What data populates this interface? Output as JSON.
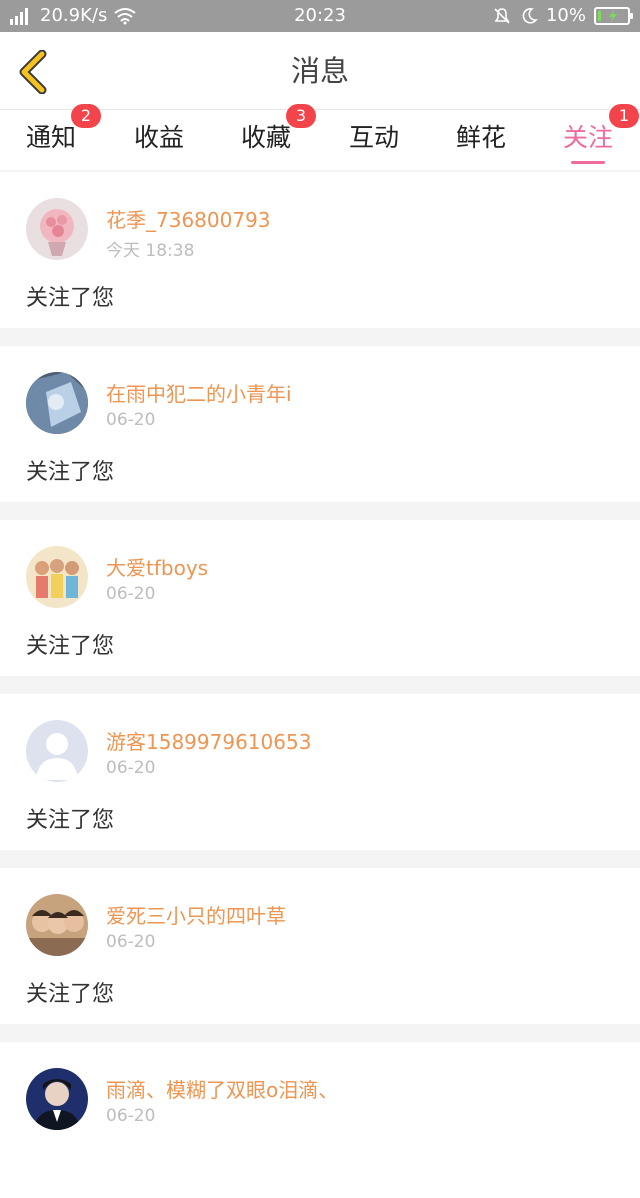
{
  "status_bar": {
    "network": "2G",
    "speed": "20.9K/s",
    "time": "20:23",
    "battery": "10%"
  },
  "header": {
    "title": "消息"
  },
  "tabs": [
    {
      "label": "通知",
      "badge": "2"
    },
    {
      "label": "收益",
      "badge": ""
    },
    {
      "label": "收藏",
      "badge": "3"
    },
    {
      "label": "互动",
      "badge": ""
    },
    {
      "label": "鲜花",
      "badge": ""
    },
    {
      "label": "关注",
      "badge": "1"
    }
  ],
  "active_tab": "关注",
  "colors": {
    "accent": "#f06a9e",
    "username": "#ee9552",
    "badge": "#f2444a",
    "back_icon": "#f6c21c"
  },
  "notifications": [
    {
      "username": "花季_736800793",
      "time": "今天 18:38",
      "message": "关注了您"
    },
    {
      "username": "在雨中犯二的小青年i",
      "time": "06-20",
      "message": "关注了您"
    },
    {
      "username": "大爱tfboys",
      "time": "06-20",
      "message": "关注了您"
    },
    {
      "username": "游客1589979610653",
      "time": "06-20",
      "message": "关注了您"
    },
    {
      "username": "爱死三小只的四叶草",
      "time": "06-20",
      "message": "关注了您"
    },
    {
      "username": "雨滴、模糊了双眼o泪滴、",
      "time": "06-20",
      "message": ""
    }
  ]
}
